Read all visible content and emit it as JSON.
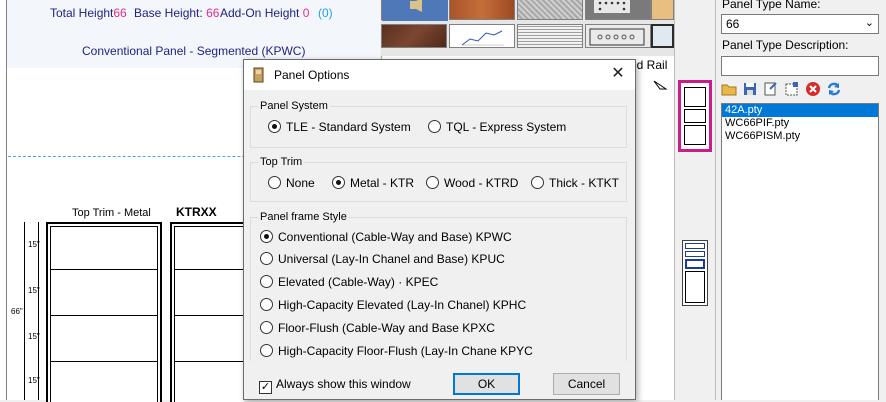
{
  "canvas": {
    "total_height_label": "Total Height",
    "total_height_value": "66",
    "base_height_label": "Base Height:",
    "base_height_value": "66",
    "addon_height_label": "Add-On Height",
    "addon_height_value": "0",
    "addon_extra": "(0)",
    "panel_title": "Conventional Panel - Segmented (KPWC)",
    "trim_label": "Top Trim - Metal",
    "part_label": "KTRXX",
    "dims": [
      "15\"",
      "15\"",
      "15\"",
      "15\""
    ],
    "height_dim": "66\""
  },
  "middle": {
    "tab_label": "ed Rail"
  },
  "right": {
    "type_name_label": "Panel Type Name:",
    "type_name_value": "66",
    "type_desc_label": "Panel Type Description:",
    "type_desc_value": "",
    "files": [
      "42A.pty",
      "WC66PIF.pty",
      "WC66PISM.pty"
    ],
    "selected_file": "42A.pty"
  },
  "dialog": {
    "title": "Panel Options",
    "close_glyph": "✕",
    "panel_system": {
      "label": "Panel System",
      "options": [
        "TLE - Standard System",
        "TQL - Express System"
      ],
      "selected": "TLE - Standard System"
    },
    "top_trim": {
      "label": "Top Trim",
      "options": [
        "None",
        "Metal - KTR",
        "Wood - KTRD",
        "Thick - KTKT"
      ],
      "selected": "Metal - KTR"
    },
    "frame_style": {
      "label": "Panel frame Style",
      "options": [
        "Conventional (Cable-Way and Base) KPWC",
        "Universal (Lay-In Chanel and Base)  KPUC",
        "Elevated (Cable-Way) · KPEC",
        "High-Capacity Elevated (Lay-In Chanel) KPHC",
        "Floor-Flush (Cable-Way and Base KPXC",
        "High-Capacity Floor-Flush (Lay-In Chane KPYC"
      ],
      "selected": "Conventional (Cable-Way and Base) KPWC"
    },
    "always_show_label": "Always show this window",
    "always_show_checked": true,
    "ok_label": "OK",
    "cancel_label": "Cancel"
  },
  "colors": {
    "accent_pink": "#e0308a",
    "accent_cyan": "#20a0e0",
    "text_navy": "#1f1f80",
    "selection_blue": "#0078d7",
    "thumb_highlight": "#c81e8c"
  },
  "icons": [
    "speaker-icon",
    "open-folder-icon",
    "save-icon",
    "save-as-icon",
    "new-icon",
    "delete-icon",
    "refresh-icon",
    "panel-options-icon"
  ]
}
